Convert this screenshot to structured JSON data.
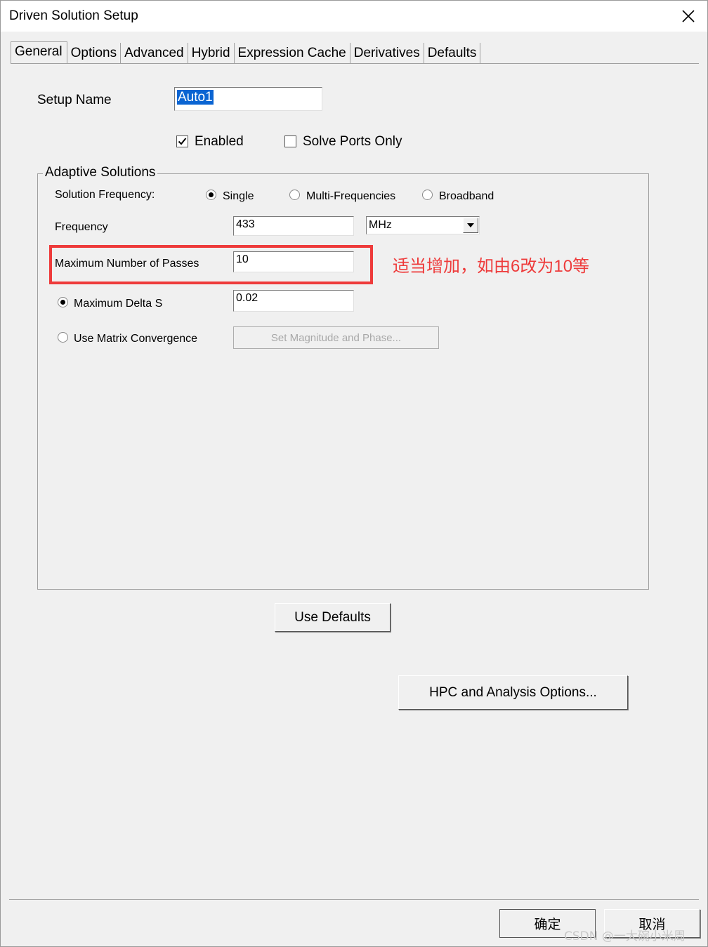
{
  "window": {
    "title": "Driven Solution Setup"
  },
  "tabs": [
    {
      "label": "General",
      "active": true
    },
    {
      "label": "Options"
    },
    {
      "label": "Advanced"
    },
    {
      "label": "Hybrid"
    },
    {
      "label": "Expression Cache"
    },
    {
      "label": "Derivatives"
    },
    {
      "label": "Defaults"
    }
  ],
  "setup": {
    "name_label": "Setup Name",
    "name_value": "Auto1",
    "enabled_label": "Enabled",
    "enabled_checked": true,
    "solve_ports_label": "Solve Ports Only",
    "solve_ports_checked": false
  },
  "adaptive": {
    "group_title": "Adaptive Solutions",
    "solution_frequency_label": "Solution Frequency:",
    "freq_options": [
      "Single",
      "Multi-Frequencies",
      "Broadband"
    ],
    "freq_selected": "Single",
    "frequency_label": "Frequency",
    "frequency_value": "433",
    "frequency_unit": "MHz",
    "max_passes_label": "Maximum Number of Passes",
    "max_passes_value": "10",
    "max_delta_label": "Maximum Delta S",
    "max_delta_value": "0.02",
    "max_delta_selected": true,
    "matrix_conv_label": "Use Matrix Convergence",
    "matrix_conv_selected": false,
    "set_mag_phase_label": "Set Magnitude and Phase..."
  },
  "buttons": {
    "use_defaults": "Use Defaults",
    "hpc": "HPC and Analysis Options...",
    "ok": "确定",
    "cancel": "取消"
  },
  "annotation": {
    "text": "适当增加，如由6改为10等",
    "color": "#ee3b3b"
  },
  "watermark": "CSDN @一大碗小米周",
  "colors": {
    "selection": "#0a64d2",
    "background": "#f0f0f0"
  }
}
